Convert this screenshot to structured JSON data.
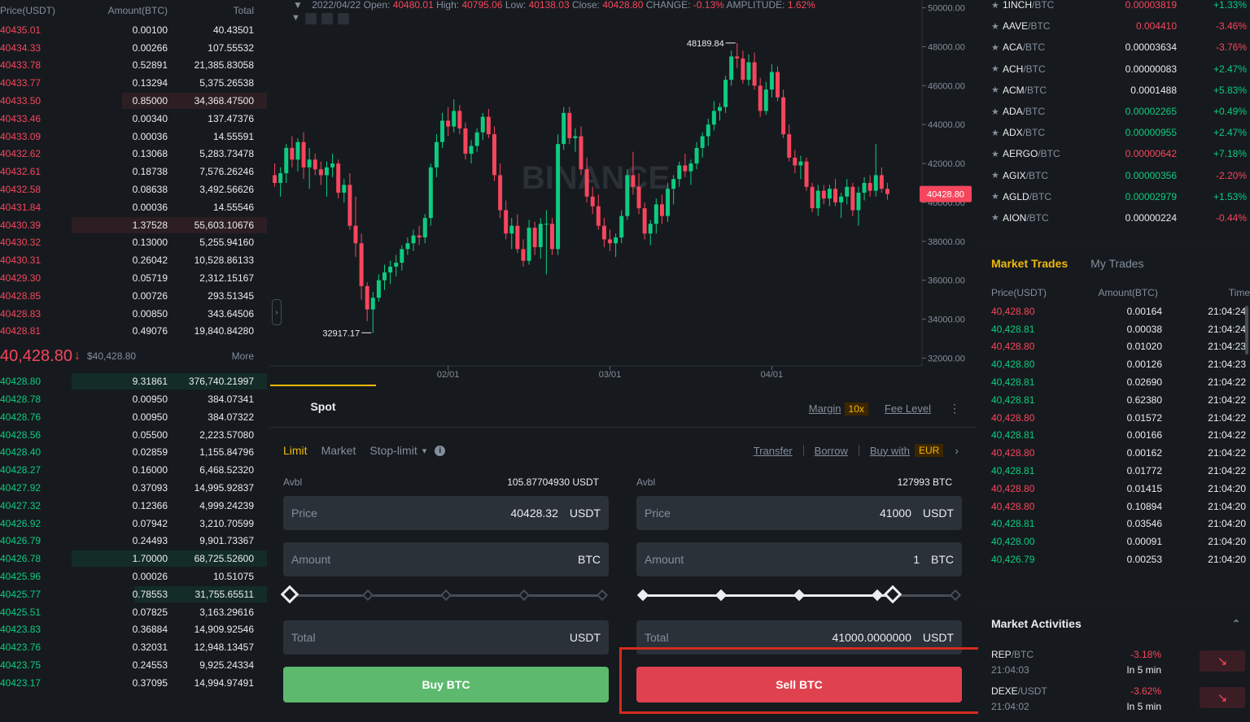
{
  "orderbook": {
    "headers": {
      "price": "Price(USDT)",
      "amount": "Amount(BTC)",
      "total": "Total"
    },
    "asks": [
      {
        "price": "40435.01",
        "amount": "0.00100",
        "total": "40.43501",
        "depth": 0
      },
      {
        "price": "40434.33",
        "amount": "0.00266",
        "total": "107.55532",
        "depth": 0
      },
      {
        "price": "40433.78",
        "amount": "0.52891",
        "total": "21,385.83058",
        "depth": 0
      },
      {
        "price": "40433.77",
        "amount": "0.13294",
        "total": "5,375.26538",
        "depth": 0
      },
      {
        "price": "40433.50",
        "amount": "0.85000",
        "total": "34,368.47500",
        "depth": 0.74
      },
      {
        "price": "40433.46",
        "amount": "0.00340",
        "total": "137.47376",
        "depth": 0
      },
      {
        "price": "40433.09",
        "amount": "0.00036",
        "total": "14.55591",
        "depth": 0
      },
      {
        "price": "40432.62",
        "amount": "0.13068",
        "total": "5,283.73478",
        "depth": 0
      },
      {
        "price": "40432.61",
        "amount": "0.18738",
        "total": "7,576.26246",
        "depth": 0
      },
      {
        "price": "40432.58",
        "amount": "0.08638",
        "total": "3,492.56626",
        "depth": 0
      },
      {
        "price": "40431.84",
        "amount": "0.00036",
        "total": "14.55546",
        "depth": 0
      },
      {
        "price": "40430.39",
        "amount": "1.37528",
        "total": "55,603.10676",
        "depth": 1.0
      },
      {
        "price": "40430.32",
        "amount": "0.13000",
        "total": "5,255.94160",
        "depth": 0
      },
      {
        "price": "40430.31",
        "amount": "0.26042",
        "total": "10,528.86133",
        "depth": 0
      },
      {
        "price": "40429.30",
        "amount": "0.05719",
        "total": "2,312.15167",
        "depth": 0
      },
      {
        "price": "40428.85",
        "amount": "0.00726",
        "total": "293.51345",
        "depth": 0
      },
      {
        "price": "40428.83",
        "amount": "0.00850",
        "total": "343.64506",
        "depth": 0
      },
      {
        "price": "40428.81",
        "amount": "0.49076",
        "total": "19,840.84280",
        "depth": 0
      }
    ],
    "last_price": "40,428.80",
    "arrow": "↓",
    "mark_price": "$40,428.80",
    "more": "More",
    "bids": [
      {
        "price": "40428.80",
        "amount": "9.31861",
        "total": "376,740.21997",
        "depth": 1.0
      },
      {
        "price": "40428.78",
        "amount": "0.00950",
        "total": "384.07341",
        "depth": 0
      },
      {
        "price": "40428.76",
        "amount": "0.00950",
        "total": "384.07322",
        "depth": 0
      },
      {
        "price": "40428.56",
        "amount": "0.05500",
        "total": "2,223.57080",
        "depth": 0
      },
      {
        "price": "40428.40",
        "amount": "0.02859",
        "total": "1,155.84796",
        "depth": 0
      },
      {
        "price": "40428.27",
        "amount": "0.16000",
        "total": "6,468.52320",
        "depth": 0
      },
      {
        "price": "40427.92",
        "amount": "0.37093",
        "total": "14,995.92837",
        "depth": 0
      },
      {
        "price": "40427.32",
        "amount": "0.12366",
        "total": "4,999.24239",
        "depth": 0
      },
      {
        "price": "40426.92",
        "amount": "0.07942",
        "total": "3,210.70599",
        "depth": 0
      },
      {
        "price": "40426.79",
        "amount": "0.24493",
        "total": "9,901.73367",
        "depth": 0
      },
      {
        "price": "40426.78",
        "amount": "1.70000",
        "total": "68,725.52600",
        "depth": 1.0
      },
      {
        "price": "40425.96",
        "amount": "0.00026",
        "total": "10.51075",
        "depth": 0
      },
      {
        "price": "40425.77",
        "amount": "0.78553",
        "total": "31,755.65511",
        "depth": 0.68
      },
      {
        "price": "40425.51",
        "amount": "0.07825",
        "total": "3,163.29616",
        "depth": 0
      },
      {
        "price": "40423.83",
        "amount": "0.36884",
        "total": "14,909.92546",
        "depth": 0
      },
      {
        "price": "40423.76",
        "amount": "0.32031",
        "total": "12,948.13457",
        "depth": 0
      },
      {
        "price": "40423.75",
        "amount": "0.24553",
        "total": "9,925.24334",
        "depth": 0
      },
      {
        "price": "40423.17",
        "amount": "0.37095",
        "total": "14,994.97491",
        "depth": 0
      }
    ]
  },
  "chart": {
    "triangle": "▼",
    "date": "2022/04/22",
    "open_label": "Open:",
    "open": "40480.01",
    "high_label": "High:",
    "high": "40795.06",
    "low_label": "Low:",
    "low": "40138.03",
    "close_label": "Close:",
    "close": "40428.80",
    "change_label": "CHANGE:",
    "change": "-0.13%",
    "amplitude_label": "AMPLITUDE:",
    "amplitude": "1.62%",
    "max_label": "48189.84",
    "min_label": "32917.17",
    "price_tag": "40428.80",
    "watermark": "BINANCE",
    "collapse": "›",
    "up_color": "#0ecb81",
    "down_color": "#f6465d"
  },
  "chart_data": {
    "type": "candlestick",
    "y_ticks": [
      "50000.00",
      "48000.00",
      "46000.00",
      "44000.00",
      "42000.00",
      "40000.00",
      "38000.00",
      "36000.00",
      "34000.00",
      "32000.00"
    ],
    "y_values": [
      50000,
      48000,
      46000,
      44000,
      42000,
      40000,
      38000,
      36000,
      34000,
      32000
    ],
    "x_ticks": [
      "02/01",
      "03/01",
      "04/01"
    ],
    "ylim": [
      31600,
      50400
    ],
    "candles": [
      [
        41400,
        42000,
        40800,
        41000
      ],
      [
        41000,
        41800,
        40300,
        41500
      ],
      [
        41500,
        43000,
        41000,
        42800
      ],
      [
        42800,
        43400,
        41800,
        42200
      ],
      [
        42200,
        43300,
        41600,
        43100
      ],
      [
        43100,
        43600,
        41200,
        41800
      ],
      [
        41800,
        42800,
        40700,
        42200
      ],
      [
        42200,
        42500,
        41400,
        41700
      ],
      [
        41700,
        42100,
        40900,
        41400
      ],
      [
        41400,
        42100,
        40300,
        41800
      ],
      [
        41800,
        42500,
        41300,
        42000
      ],
      [
        42000,
        42200,
        40200,
        40500
      ],
      [
        40500,
        41200,
        40000,
        40900
      ],
      [
        40900,
        41500,
        38600,
        38800
      ],
      [
        38800,
        40300,
        37200,
        37900
      ],
      [
        37900,
        38400,
        35000,
        35700
      ],
      [
        35700,
        35900,
        33900,
        34500
      ],
      [
        34500,
        35400,
        33300,
        35100
      ],
      [
        35100,
        36300,
        34900,
        36000
      ],
      [
        36000,
        36800,
        35500,
        36400
      ],
      [
        36400,
        37000,
        35800,
        36700
      ],
      [
        36700,
        37300,
        36200,
        36900
      ],
      [
        36900,
        37800,
        36500,
        37600
      ],
      [
        37600,
        38200,
        37300,
        37900
      ],
      [
        37900,
        38600,
        37500,
        38300
      ],
      [
        38300,
        38800,
        37800,
        38200
      ],
      [
        38200,
        39400,
        37900,
        39200
      ],
      [
        39200,
        42000,
        38800,
        41800
      ],
      [
        41800,
        43500,
        41300,
        43100
      ],
      [
        43100,
        44600,
        42800,
        44200
      ],
      [
        44200,
        44900,
        43400,
        43900
      ],
      [
        43900,
        45300,
        43600,
        44700
      ],
      [
        44700,
        45000,
        43500,
        43800
      ],
      [
        43800,
        44100,
        42200,
        42500
      ],
      [
        42500,
        43200,
        42000,
        42900
      ],
      [
        42900,
        43800,
        42600,
        43600
      ],
      [
        43600,
        44600,
        43200,
        44400
      ],
      [
        44400,
        44800,
        43300,
        43500
      ],
      [
        43500,
        43900,
        41100,
        41400
      ],
      [
        41400,
        42000,
        39200,
        39600
      ],
      [
        39600,
        40100,
        38100,
        38400
      ],
      [
        38400,
        39200,
        37600,
        38800
      ],
      [
        38800,
        39400,
        37400,
        37600
      ],
      [
        37600,
        38100,
        36700,
        37000
      ],
      [
        37000,
        39100,
        36800,
        38700
      ],
      [
        38700,
        39000,
        37300,
        37700
      ],
      [
        37700,
        39200,
        37100,
        38900
      ],
      [
        38900,
        39600,
        36300,
        38900
      ],
      [
        38900,
        39200,
        37300,
        37600
      ],
      [
        37600,
        43500,
        37300,
        43000
      ],
      [
        43000,
        44900,
        42700,
        44600
      ],
      [
        44600,
        44900,
        43000,
        43300
      ],
      [
        43300,
        43800,
        42600,
        43400
      ],
      [
        43400,
        43900,
        41400,
        41700
      ],
      [
        41700,
        42300,
        40000,
        40300
      ],
      [
        40300,
        40800,
        39400,
        39800
      ],
      [
        39800,
        40400,
        38600,
        38800
      ],
      [
        38800,
        39200,
        37700,
        38100
      ],
      [
        38100,
        38600,
        37500,
        37900
      ],
      [
        37900,
        38400,
        37200,
        38200
      ],
      [
        38200,
        39600,
        37900,
        39300
      ],
      [
        39300,
        41700,
        39100,
        41400
      ],
      [
        41400,
        42600,
        40400,
        40800
      ],
      [
        40800,
        41500,
        39400,
        39700
      ],
      [
        39700,
        40000,
        38100,
        38400
      ],
      [
        38400,
        39100,
        37800,
        38900
      ],
      [
        38900,
        40200,
        38400,
        39900
      ],
      [
        39900,
        40400,
        38900,
        39300
      ],
      [
        39300,
        41000,
        39000,
        40700
      ],
      [
        40700,
        41400,
        39900,
        41200
      ],
      [
        41200,
        42100,
        40800,
        41900
      ],
      [
        41900,
        42500,
        41300,
        41600
      ],
      [
        41600,
        42200,
        40900,
        42000
      ],
      [
        42000,
        43100,
        41700,
        42800
      ],
      [
        42800,
        43600,
        42300,
        43400
      ],
      [
        43400,
        44300,
        42900,
        44000
      ],
      [
        44000,
        45200,
        43700,
        44700
      ],
      [
        44700,
        45100,
        44200,
        44900
      ],
      [
        44900,
        46500,
        44600,
        46300
      ],
      [
        46300,
        47800,
        46000,
        47500
      ],
      [
        47500,
        48190,
        46900,
        47400
      ],
      [
        47400,
        47800,
        46100,
        46300
      ],
      [
        46300,
        47600,
        46000,
        47200
      ],
      [
        47200,
        47700,
        45800,
        46000
      ],
      [
        46000,
        46400,
        44400,
        44700
      ],
      [
        44700,
        46200,
        44500,
        45800
      ],
      [
        45800,
        47100,
        45400,
        46700
      ],
      [
        46700,
        47000,
        45200,
        45400
      ],
      [
        45400,
        45800,
        43300,
        43500
      ],
      [
        43500,
        44000,
        42100,
        42300
      ],
      [
        42300,
        42700,
        41500,
        41900
      ],
      [
        41900,
        42400,
        41200,
        42100
      ],
      [
        42100,
        42300,
        40600,
        40800
      ],
      [
        40800,
        41000,
        39500,
        39700
      ],
      [
        39700,
        40900,
        39300,
        40600
      ],
      [
        40600,
        40900,
        39900,
        40200
      ],
      [
        40200,
        40900,
        39800,
        40700
      ],
      [
        40700,
        41200,
        39800,
        40000
      ],
      [
        40000,
        40500,
        39200,
        40300
      ],
      [
        40300,
        41200,
        39900,
        40800
      ],
      [
        40800,
        41000,
        39300,
        39600
      ],
      [
        39600,
        40800,
        38800,
        40500
      ],
      [
        40500,
        41300,
        40100,
        41000
      ],
      [
        41000,
        41400,
        40300,
        40600
      ],
      [
        40600,
        43000,
        40300,
        41400
      ],
      [
        41400,
        41800,
        40500,
        40700
      ],
      [
        40700,
        41000,
        40138,
        40428.8
      ]
    ]
  },
  "trade": {
    "tab": "Spot",
    "margin": "Margin",
    "leverage": "10x",
    "fee_level": "Fee Level",
    "more": "⋮",
    "order_types": [
      "Limit",
      "Market",
      "Stop-limit"
    ],
    "stop_caret": "▾",
    "info": "i",
    "transfer": "Transfer",
    "borrow": "Borrow",
    "buy_with": "Buy with",
    "currency": "EUR",
    "chevron": "›",
    "buy": {
      "avbl_label": "Avbl",
      "avbl": "105.87704930 USDT",
      "price_label": "Price",
      "price": "40428.32",
      "price_unit": "USDT",
      "amount_label": "Amount",
      "amount": "",
      "amount_unit": "BTC",
      "slider_fraction": 0,
      "total_label": "Total",
      "total": "",
      "total_unit": "USDT",
      "button": "Buy BTC"
    },
    "sell": {
      "avbl_label": "Avbl",
      "avbl": "127993 BTC",
      "price_label": "Price",
      "price": "41000",
      "price_unit": "USDT",
      "amount_label": "Amount",
      "amount": "1",
      "amount_unit": "BTC",
      "slider_fraction": 0.8,
      "total_label": "Total",
      "total": "41000.0000000",
      "total_unit": "USDT",
      "button": "Sell BTC"
    }
  },
  "markets": [
    {
      "base": "1INCH",
      "quote": "/BTC",
      "price": "0.00003819",
      "pclass": "red",
      "change": "+1.33%",
      "cclass": "green"
    },
    {
      "base": "AAVE",
      "quote": "/BTC",
      "price": "0.004410",
      "pclass": "red",
      "change": "-3.46%",
      "cclass": "red"
    },
    {
      "base": "ACA",
      "quote": "/BTC",
      "price": "0.00003634",
      "pclass": "white",
      "change": "-3.76%",
      "cclass": "red"
    },
    {
      "base": "ACH",
      "quote": "/BTC",
      "price": "0.00000083",
      "pclass": "white",
      "change": "+2.47%",
      "cclass": "green"
    },
    {
      "base": "ACM",
      "quote": "/BTC",
      "price": "0.0001488",
      "pclass": "white",
      "change": "+5.83%",
      "cclass": "green"
    },
    {
      "base": "ADA",
      "quote": "/BTC",
      "price": "0.00002265",
      "pclass": "green",
      "change": "+0.49%",
      "cclass": "green"
    },
    {
      "base": "ADX",
      "quote": "/BTC",
      "price": "0.00000955",
      "pclass": "green",
      "change": "+2.47%",
      "cclass": "green"
    },
    {
      "base": "AERGO",
      "quote": "/BTC",
      "price": "0.00000642",
      "pclass": "red",
      "change": "+7.18%",
      "cclass": "green"
    },
    {
      "base": "AGIX",
      "quote": "/BTC",
      "price": "0.00000356",
      "pclass": "green",
      "change": "-2.20%",
      "cclass": "red"
    },
    {
      "base": "AGLD",
      "quote": "/BTC",
      "price": "0.00002979",
      "pclass": "green",
      "change": "+1.53%",
      "cclass": "green"
    },
    {
      "base": "AION",
      "quote": "/BTC",
      "price": "0.00000224",
      "pclass": "white",
      "change": "-0.44%",
      "cclass": "red"
    }
  ],
  "market_trades": {
    "tab_active": "Market Trades",
    "tab_other": "My Trades",
    "headers": {
      "price": "Price(USDT)",
      "amount": "Amount(BTC)",
      "time": "Time"
    },
    "rows": [
      {
        "price": "40,428.80",
        "side": "red",
        "amount": "0.00164",
        "time": "21:04:24"
      },
      {
        "price": "40,428.81",
        "side": "green",
        "amount": "0.00038",
        "time": "21:04:24"
      },
      {
        "price": "40,428.80",
        "side": "red",
        "amount": "0.01020",
        "time": "21:04:23"
      },
      {
        "price": "40,428.80",
        "side": "green",
        "amount": "0.00126",
        "time": "21:04:23"
      },
      {
        "price": "40,428.81",
        "side": "green",
        "amount": "0.02690",
        "time": "21:04:22"
      },
      {
        "price": "40,428.81",
        "side": "green",
        "amount": "0.62380",
        "time": "21:04:22"
      },
      {
        "price": "40,428.80",
        "side": "red",
        "amount": "0.01572",
        "time": "21:04:22"
      },
      {
        "price": "40,428.81",
        "side": "green",
        "amount": "0.00166",
        "time": "21:04:22"
      },
      {
        "price": "40,428.80",
        "side": "red",
        "amount": "0.00162",
        "time": "21:04:22"
      },
      {
        "price": "40,428.81",
        "side": "green",
        "amount": "0.01772",
        "time": "21:04:22"
      },
      {
        "price": "40,428.80",
        "side": "red",
        "amount": "0.01415",
        "time": "21:04:20"
      },
      {
        "price": "40,428.80",
        "side": "red",
        "amount": "0.10894",
        "time": "21:04:20"
      },
      {
        "price": "40,428.81",
        "side": "green",
        "amount": "0.03546",
        "time": "21:04:20"
      },
      {
        "price": "40,428.00",
        "side": "green",
        "amount": "0.00091",
        "time": "21:04:20"
      },
      {
        "price": "40,426.79",
        "side": "green",
        "amount": "0.00253",
        "time": "21:04:20"
      }
    ]
  },
  "activities": {
    "title": "Market Activities",
    "caret": "⌃",
    "rows": [
      {
        "base": "REP",
        "quote": "/BTC",
        "time": "21:04:03",
        "change": "-3.18%",
        "duration": "In 5 min",
        "icon": "↘"
      },
      {
        "base": "DEXE",
        "quote": "/USDT",
        "time": "21:04:02",
        "change": "-3.62%",
        "duration": "In 5 min",
        "icon": "↘"
      }
    ]
  }
}
